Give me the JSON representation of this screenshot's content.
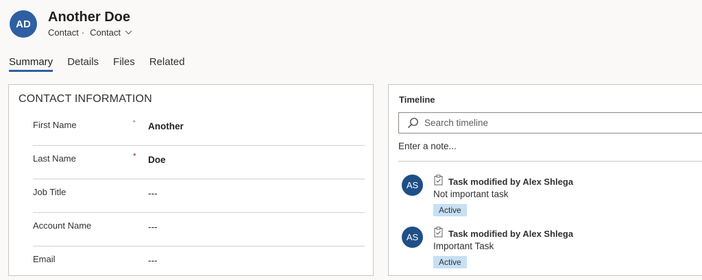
{
  "header": {
    "avatar_initials": "AD",
    "avatar_color": "#2e5fa3",
    "title": "Another Doe",
    "entity": "Contact",
    "separator": "·",
    "form_selector": "Contact"
  },
  "tabs": [
    {
      "label": "Summary",
      "active": true
    },
    {
      "label": "Details",
      "active": false
    },
    {
      "label": "Files",
      "active": false
    },
    {
      "label": "Related",
      "active": false
    }
  ],
  "contact_section": {
    "title": "CONTACT INFORMATION",
    "fields": [
      {
        "label": "First Name",
        "required_marker": "*",
        "required_color": "#2e5fa3",
        "value": "Another"
      },
      {
        "label": "Last Name",
        "required_marker": "*",
        "required_color": "#a4262c",
        "value": "Doe"
      },
      {
        "label": "Job Title",
        "required_marker": "",
        "value": "---"
      },
      {
        "label": "Account Name",
        "required_marker": "",
        "value": "---"
      },
      {
        "label": "Email",
        "required_marker": "",
        "value": "---"
      }
    ]
  },
  "timeline": {
    "title": "Timeline",
    "search_placeholder": "Search timeline",
    "note_placeholder": "Enter a note...",
    "items": [
      {
        "avatar_initials": "AS",
        "icon": "task-icon",
        "header": "Task modified by Alex Shlega",
        "description": "Not important task",
        "status": "Active"
      },
      {
        "avatar_initials": "AS",
        "icon": "task-icon",
        "header": "Task modified by Alex Shlega",
        "description": "Important Task",
        "status": "Active"
      }
    ]
  },
  "colors": {
    "accent": "#2e5fa3",
    "badge_bg": "#c7e0f4",
    "required_red": "#a4262c"
  }
}
